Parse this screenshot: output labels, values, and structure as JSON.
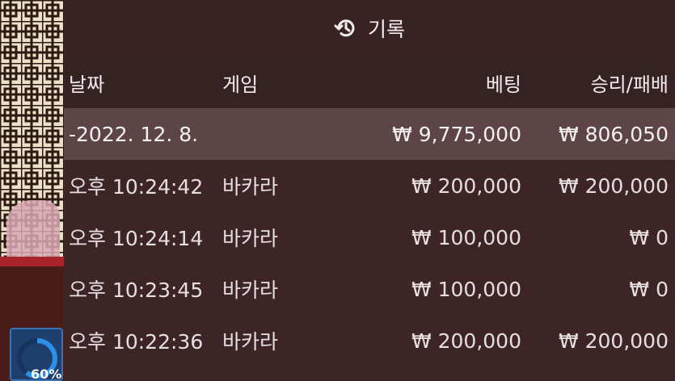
{
  "panel": {
    "title": "기록",
    "icon": "history-icon"
  },
  "columns": {
    "date": "날짜",
    "game": "게임",
    "bet": "베팅",
    "result": "승리/패배"
  },
  "summary": {
    "date": "-2022. 12. 8.",
    "bet": "₩ 9,775,000",
    "result": "₩ 806,050"
  },
  "rows": [
    {
      "time": "오후 10:24:42",
      "game": "바카라",
      "bet": "₩ 200,000",
      "result": "₩ 200,000"
    },
    {
      "time": "오후 10:24:14",
      "game": "바카라",
      "bet": "₩ 100,000",
      "result": "₩ 0"
    },
    {
      "time": "오후 10:23:45",
      "game": "바카라",
      "bet": "₩ 100,000",
      "result": "₩ 0"
    },
    {
      "time": "오후 10:22:36",
      "game": "바카라",
      "bet": "₩ 200,000",
      "result": "₩ 200,000"
    }
  ],
  "progress_widget": {
    "label": "60%",
    "value": 0.6
  },
  "colors": {
    "panel_bg": "#3e2628",
    "summary_row_bg": "#786062",
    "text": "#f1eaea",
    "lattice": "#2b1a12",
    "widget_bg": "#1e3f6e",
    "widget_ring": "#2e8fe8"
  }
}
